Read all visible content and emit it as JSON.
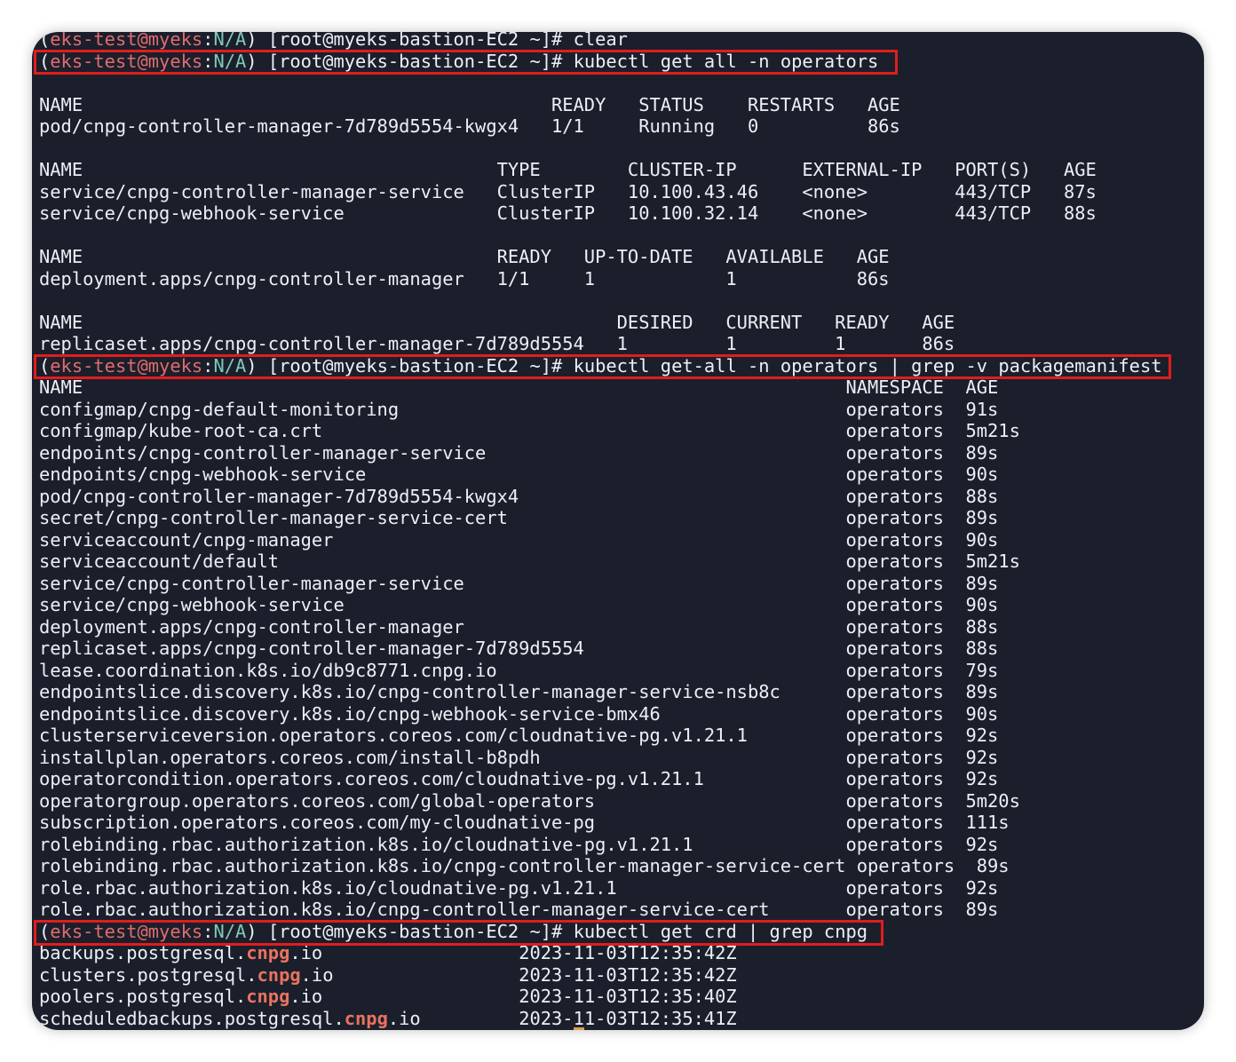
{
  "prompt": {
    "open": "(",
    "user": "eks-test@myeks",
    "sep": ":",
    "ctx": "N/A",
    "close": ") [root@myeks-bastion-EC2 ~]# "
  },
  "commands": {
    "clear": "clear",
    "get_all": "kubectl get all -n operators",
    "get_all_grep": "kubectl get-all -n operators | grep -v packagemanifest",
    "get_crd": "kubectl get crd | grep cnpg"
  },
  "get_all_output": [
    "",
    "NAME                                           READY   STATUS    RESTARTS   AGE",
    "pod/cnpg-controller-manager-7d789d5554-kwgx4   1/1     Running   0          86s",
    "",
    "NAME                                      TYPE        CLUSTER-IP      EXTERNAL-IP   PORT(S)   AGE",
    "service/cnpg-controller-manager-service   ClusterIP   10.100.43.46    <none>        443/TCP   87s",
    "service/cnpg-webhook-service              ClusterIP   10.100.32.14    <none>        443/TCP   88s",
    "",
    "NAME                                      READY   UP-TO-DATE   AVAILABLE   AGE",
    "deployment.apps/cnpg-controller-manager   1/1     1            1           86s",
    "",
    "NAME                                                 DESIRED   CURRENT   READY   AGE",
    "replicaset.apps/cnpg-controller-manager-7d789d5554   1         1         1       86s"
  ],
  "get_all_grep_output": [
    "NAME                                                                      NAMESPACE  AGE",
    "configmap/cnpg-default-monitoring                                         operators  91s",
    "configmap/kube-root-ca.crt                                                operators  5m21s",
    "endpoints/cnpg-controller-manager-service                                 operators  89s",
    "endpoints/cnpg-webhook-service                                            operators  90s",
    "pod/cnpg-controller-manager-7d789d5554-kwgx4                              operators  88s",
    "secret/cnpg-controller-manager-service-cert                               operators  89s",
    "serviceaccount/cnpg-manager                                               operators  90s",
    "serviceaccount/default                                                    operators  5m21s",
    "service/cnpg-controller-manager-service                                   operators  89s",
    "service/cnpg-webhook-service                                              operators  90s",
    "deployment.apps/cnpg-controller-manager                                   operators  88s",
    "replicaset.apps/cnpg-controller-manager-7d789d5554                        operators  88s",
    "lease.coordination.k8s.io/db9c8771.cnpg.io                                operators  79s",
    "endpointslice.discovery.k8s.io/cnpg-controller-manager-service-nsb8c      operators  89s",
    "endpointslice.discovery.k8s.io/cnpg-webhook-service-bmx46                 operators  90s",
    "clusterserviceversion.operators.coreos.com/cloudnative-pg.v1.21.1         operators  92s",
    "installplan.operators.coreos.com/install-b8pdh                            operators  92s",
    "operatorcondition.operators.coreos.com/cloudnative-pg.v1.21.1             operators  92s",
    "operatorgroup.operators.coreos.com/global-operators                       operators  5m20s",
    "subscription.operators.coreos.com/my-cloudnative-pg                       operators  111s",
    "rolebinding.rbac.authorization.k8s.io/cloudnative-pg.v1.21.1              operators  92s",
    "rolebinding.rbac.authorization.k8s.io/cnpg-controller-manager-service-cert operators  89s",
    "role.rbac.authorization.k8s.io/cloudnative-pg.v1.21.1                     operators  92s",
    "role.rbac.authorization.k8s.io/cnpg-controller-manager-service-cert       operators  89s"
  ],
  "crd_output": [
    {
      "pre": "backups.postgresql.",
      "hl": "cnpg",
      "post": ".io",
      "pad": "                  ",
      "created": "2023-11-03T12:35:42Z"
    },
    {
      "pre": "clusters.postgresql.",
      "hl": "cnpg",
      "post": ".io",
      "pad": "                 ",
      "created": "2023-11-03T12:35:42Z"
    },
    {
      "pre": "poolers.postgresql.",
      "hl": "cnpg",
      "post": ".io",
      "pad": "                  ",
      "created": "2023-11-03T12:35:40Z"
    },
    {
      "pre": "scheduledbackups.postgresql.",
      "hl": "cnpg",
      "post": ".io",
      "pad": "         ",
      "created": "2023-11-03T12:35:41Z"
    }
  ],
  "colors": {
    "background": "#1b1f2c",
    "text": "#eceff4",
    "prompt_user": "#e06c6c",
    "prompt_ctx": "#7ec9b8",
    "match_highlight": "#e8735f",
    "annotation_box": "#e01d1d"
  }
}
